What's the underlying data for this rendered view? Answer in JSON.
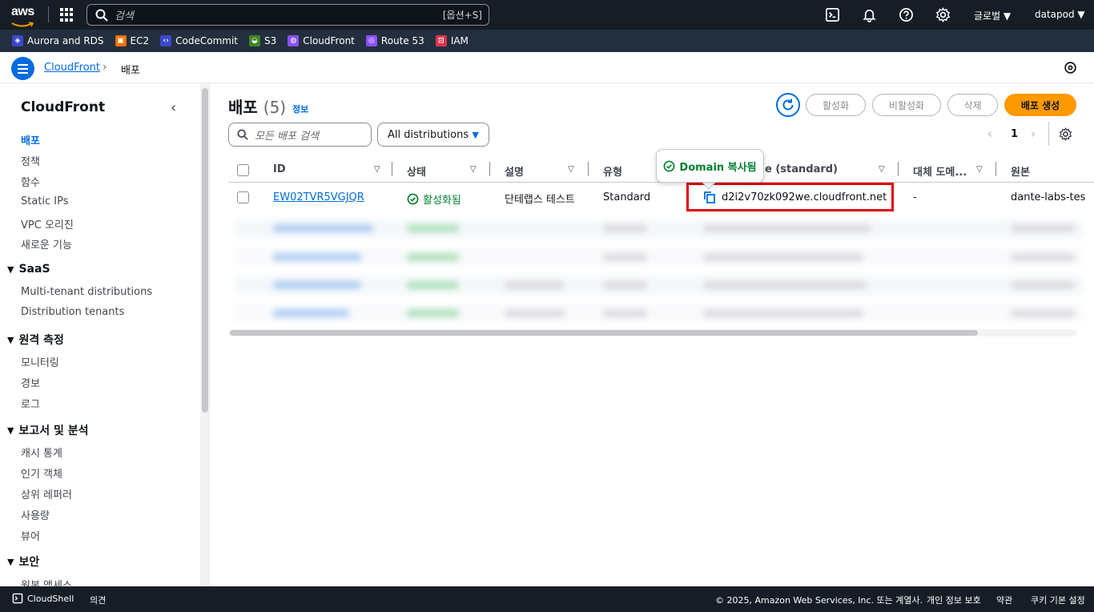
{
  "topnav": {
    "logo": "aws",
    "search_placeholder": "검색",
    "search_shortcut": "[옵션+S]",
    "region": "글로벌 ▼",
    "account": "datapod ▼"
  },
  "favorites": [
    {
      "label": "Aurora and RDS",
      "color": "#3b48cc",
      "icon": "database-icon"
    },
    {
      "label": "EC2",
      "color": "#ed7100",
      "icon": "chip-icon"
    },
    {
      "label": "CodeCommit",
      "color": "#3b48cc",
      "icon": "code-icon"
    },
    {
      "label": "S3",
      "color": "#3f8624",
      "icon": "bucket-icon"
    },
    {
      "label": "CloudFront",
      "color": "#8c4fff",
      "icon": "globe-icon"
    },
    {
      "label": "Route 53",
      "color": "#8c4fff",
      "icon": "route-icon"
    },
    {
      "label": "IAM",
      "color": "#dd344c",
      "icon": "shield-icon"
    }
  ],
  "breadcrumb": {
    "parent": "CloudFront",
    "current": "배포"
  },
  "sidebar": {
    "title": "CloudFront",
    "items": [
      "배포",
      "정책",
      "함수",
      "Static IPs",
      "VPC 오리진",
      "새로운 기능"
    ],
    "saas": {
      "title": "SaaS",
      "items": [
        "Multi-tenant distributions",
        "Distribution tenants"
      ]
    },
    "telemetry": {
      "title": "원격 측정",
      "items": [
        "모니터링",
        "경보",
        "로그"
      ]
    },
    "reports": {
      "title": "보고서 및 분석",
      "items": [
        "캐시 통계",
        "인기 객체",
        "상위 레퍼러",
        "사용량",
        "뷰어"
      ]
    },
    "security": {
      "title": "보안",
      "items": [
        "원본 액세스"
      ]
    }
  },
  "main": {
    "title": "배포",
    "count": "(5)",
    "info": "정보",
    "buttons": {
      "enable": "활성화",
      "disable": "비활성화",
      "delete": "삭제",
      "create": "배포 생성"
    },
    "filter_placeholder": "모든 배포 검색",
    "filter_select": "All distributions",
    "page": "1"
  },
  "table": {
    "headers": {
      "id": "ID",
      "status": "상태",
      "description": "설명",
      "type": "유형",
      "domain": "e (standard)",
      "alt_domain": "대체 도메...",
      "origin": "원본"
    },
    "row": {
      "id": "EW02TVR5VGJQR",
      "status": "활성화됨",
      "description": "단테랩스 테스트",
      "type": "Standard",
      "domain": "d2i2v70zk092we.cloudfront.net",
      "alt_domain": "-",
      "origin": "dante-labs-tes"
    }
  },
  "tooltip": "Domain 복사됨",
  "footer": {
    "cloudshell": "CloudShell",
    "feedback": "의견",
    "copyright": "© 2025, Amazon Web Services, Inc. 또는 계열사.",
    "privacy": "개인 정보 보호",
    "terms": "약관",
    "cookies": "쿠키 기본 설정"
  }
}
